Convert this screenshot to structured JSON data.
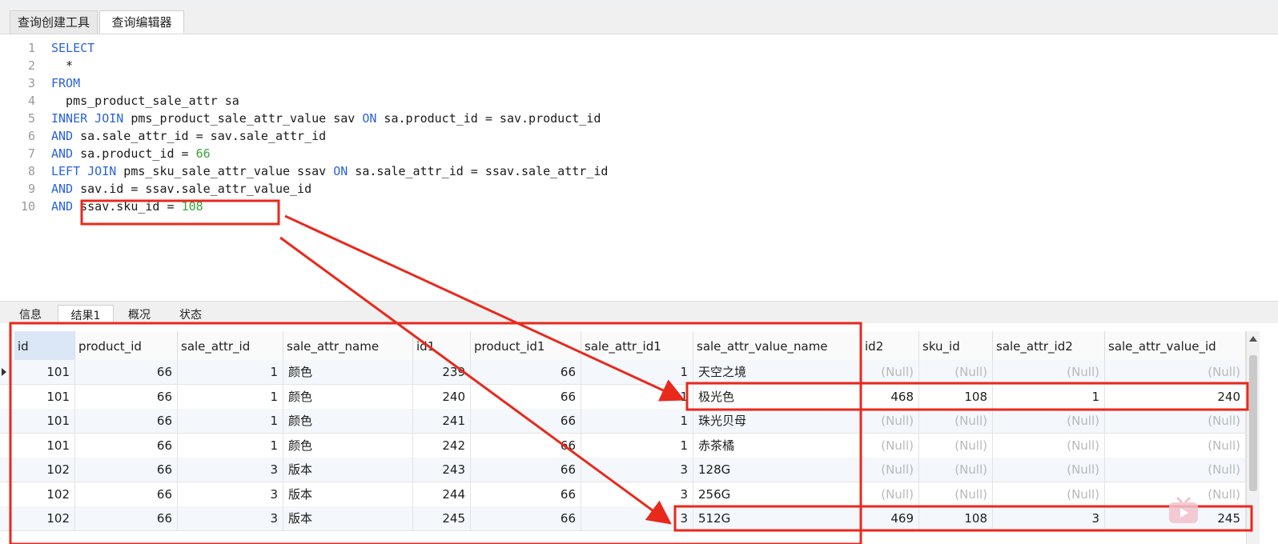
{
  "tabs": [
    "查询创建工具",
    "查询编辑器"
  ],
  "sql_lines": [
    {
      "n": "1",
      "parts": [
        [
          "kw",
          "SELECT"
        ]
      ]
    },
    {
      "n": "2",
      "parts": [
        [
          "t",
          "  *"
        ]
      ]
    },
    {
      "n": "3",
      "parts": [
        [
          "kw",
          "FROM"
        ]
      ]
    },
    {
      "n": "4",
      "parts": [
        [
          "t",
          "  pms_product_sale_attr sa"
        ]
      ]
    },
    {
      "n": "5",
      "parts": [
        [
          "kw",
          "INNER JOIN"
        ],
        [
          "t",
          " pms_product_sale_attr_value sav "
        ],
        [
          "kw",
          "ON"
        ],
        [
          "t",
          " sa.product_id = sav.product_id"
        ]
      ]
    },
    {
      "n": "6",
      "parts": [
        [
          "kw",
          "AND"
        ],
        [
          "t",
          " sa.sale_attr_id = sav.sale_attr_id"
        ]
      ]
    },
    {
      "n": "7",
      "parts": [
        [
          "kw",
          "AND"
        ],
        [
          "t",
          " sa.product_id = "
        ],
        [
          "num",
          "66"
        ]
      ]
    },
    {
      "n": "8",
      "parts": [
        [
          "kw",
          "LEFT JOIN"
        ],
        [
          "t",
          " pms_sku_sale_attr_value ssav "
        ],
        [
          "kw",
          "ON"
        ],
        [
          "t",
          " sa.sale_attr_id = ssav.sale_attr_id"
        ]
      ]
    },
    {
      "n": "9",
      "parts": [
        [
          "kw",
          "AND"
        ],
        [
          "t",
          " sav.id = ssav.sale_attr_value_id"
        ]
      ]
    },
    {
      "n": "10",
      "parts": [
        [
          "kw",
          "AND"
        ],
        [
          "t",
          " ssav.sku_id = "
        ],
        [
          "num",
          "108"
        ]
      ]
    }
  ],
  "result_tabs": [
    "信息",
    "结果1",
    "概况",
    "状态"
  ],
  "columns": [
    "id",
    "product_id",
    "sale_attr_id",
    "sale_attr_name",
    "id1",
    "product_id1",
    "sale_attr_id1",
    "sale_attr_value_name",
    "id2",
    "sku_id",
    "sale_attr_id2",
    "sale_attr_value_id"
  ],
  "rows": [
    [
      "101",
      "66",
      "1",
      "颜色",
      "239",
      "66",
      "1",
      "天空之境",
      "(Null)",
      "(Null)",
      "(Null)",
      "(Null)"
    ],
    [
      "101",
      "66",
      "1",
      "颜色",
      "240",
      "66",
      "1",
      "极光色",
      "468",
      "108",
      "1",
      "240"
    ],
    [
      "101",
      "66",
      "1",
      "颜色",
      "241",
      "66",
      "1",
      "珠光贝母",
      "(Null)",
      "(Null)",
      "(Null)",
      "(Null)"
    ],
    [
      "101",
      "66",
      "1",
      "颜色",
      "242",
      "66",
      "1",
      "赤茶橘",
      "(Null)",
      "(Null)",
      "(Null)",
      "(Null)"
    ],
    [
      "102",
      "66",
      "3",
      "版本",
      "243",
      "66",
      "3",
      "128G",
      "(Null)",
      "(Null)",
      "(Null)",
      "(Null)"
    ],
    [
      "102",
      "66",
      "3",
      "版本",
      "244",
      "66",
      "3",
      "256G",
      "(Null)",
      "(Null)",
      "(Null)",
      "(Null)"
    ],
    [
      "102",
      "66",
      "3",
      "版本",
      "245",
      "66",
      "3",
      "512G",
      "469",
      "108",
      "3",
      "245"
    ]
  ],
  "colors": {
    "keyword": "#2a63d9",
    "number": "#3aa43a",
    "annotation": "#e8291c",
    "null": "#b9b9b9"
  }
}
